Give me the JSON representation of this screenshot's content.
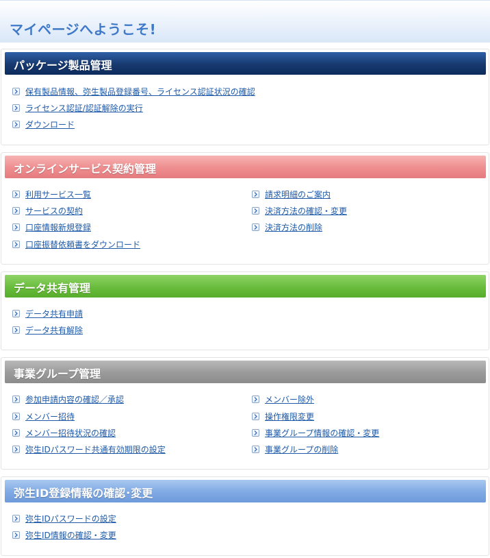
{
  "welcome": {
    "title": "マイページへようこそ!"
  },
  "sections": {
    "package": {
      "title": "パッケージ製品管理",
      "links": [
        "保有製品情報、弥生製品登録番号、ライセンス認証状況の確認",
        "ライセンス認証/認証解除の実行",
        "ダウンロード"
      ]
    },
    "online": {
      "title": "オンラインサービス契約管理",
      "left_links": [
        "利用サービス一覧",
        "サービスの契約",
        "口座情報新規登録",
        "口座振替依頼書をダウンロード"
      ],
      "right_links": [
        "請求明細のご案内",
        "決済方法の確認・変更",
        "決済方法の削除"
      ]
    },
    "datashare": {
      "title": "データ共有管理",
      "links": [
        "データ共有申請",
        "データ共有解除"
      ]
    },
    "group": {
      "title": "事業グループ管理",
      "left_links": [
        "参加申請内容の確認／承認",
        "メンバー招待",
        "メンバー招待状況の確認",
        "弥生IDパスワード共通有効期限の設定"
      ],
      "right_links": [
        "メンバー除外",
        "操作権限変更",
        "事業グループ情報の確認・変更",
        "事業グループの削除"
      ]
    },
    "yayoiid": {
      "title": "弥生ID登録情報の確認･変更",
      "links": [
        "弥生IDパスワードの設定",
        "弥生ID情報の確認・変更"
      ]
    }
  },
  "colors": {
    "link": "#1e5aa8",
    "welcome_title": "#3f79c8",
    "header_package": "#17396f",
    "header_online": "#ee8d8f",
    "header_datashare": "#69bc3c",
    "header_group": "#9a9a9a",
    "header_yayoiid": "#7fa9e3"
  },
  "icons": {
    "link_arrow": "chevron-right-box-icon"
  }
}
